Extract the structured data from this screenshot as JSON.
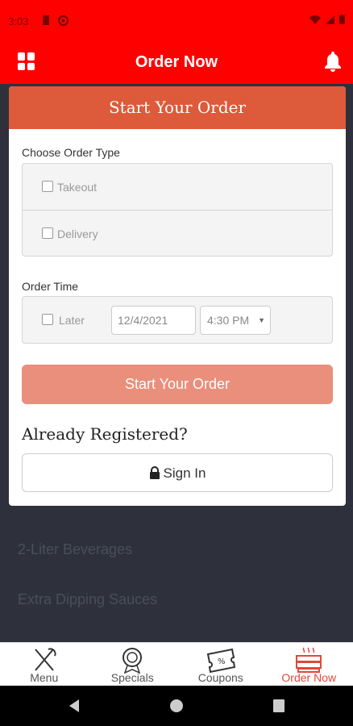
{
  "status_bar": {
    "time": "3:03"
  },
  "app_bar": {
    "title": "Order Now"
  },
  "background_list": {
    "items": [
      "2-Liter Beverages",
      "Extra Dipping Sauces"
    ]
  },
  "card": {
    "header": "Start Your Order",
    "order_type": {
      "label": "Choose Order Type",
      "options": [
        {
          "label": "Takeout",
          "checked": false
        },
        {
          "label": "Delivery",
          "checked": false
        }
      ]
    },
    "order_time": {
      "label": "Order Time",
      "later_label": "Later",
      "date_value": "12/4/2021",
      "time_value": "4:30 PM"
    },
    "start_button": "Start Your Order",
    "registered_heading": "Already Registered?",
    "signin_button": "Sign In"
  },
  "tabs": [
    {
      "label": "Menu",
      "icon": "fork-knife-icon",
      "active": false
    },
    {
      "label": "Specials",
      "icon": "badge-icon",
      "active": false
    },
    {
      "label": "Coupons",
      "icon": "coupon-icon",
      "active": false
    },
    {
      "label": "Order Now",
      "icon": "pizza-box-icon",
      "active": true
    }
  ],
  "colors": {
    "brand_red": "#ff0000",
    "card_header": "#dd5a3a",
    "button_salmon": "#e98f7b",
    "active_tab": "#e3473a"
  }
}
